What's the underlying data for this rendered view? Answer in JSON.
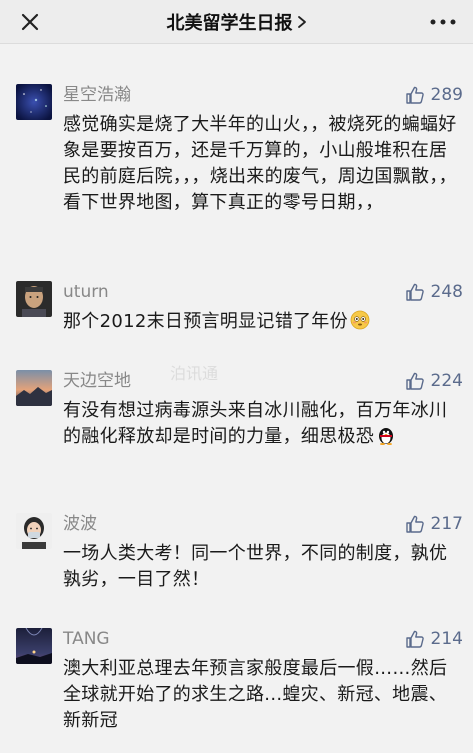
{
  "header": {
    "title": "北美留学生日报",
    "chevron_icon": "chevron-right-icon",
    "close_icon": "close-icon",
    "more_icon": "more-dots-icon"
  },
  "comments": [
    {
      "nickname": "星空浩瀚",
      "likes": "289",
      "text": "感觉确实是烧了大半年的山火，，被烧死的蝙蝠好象是要按百万，还是千万算的，小山般堆积在居民的前庭后院，，，烧出来的废气，周边国飘散，，看下世界地图，算下真正的零号日期，，"
    },
    {
      "nickname": "uturn",
      "likes": "248",
      "text": "那个2012末日预言明显记错了年份",
      "emoji": "flushed-face-emoji"
    },
    {
      "nickname": "天边空地",
      "likes": "224",
      "text": "有没有想过病毒源头来自冰川融化，百万年冰川的融化释放却是时间的力量，细思极恐",
      "emoji": "penguin-emoji"
    },
    {
      "nickname": "波波",
      "likes": "217",
      "text": "一场人类大考！同一个世界，不同的制度，孰优孰劣，一目了然！"
    },
    {
      "nickname": "TANG",
      "likes": "214",
      "text": "澳大利亚总理去年预言家般度最后一假……然后全球就开始了的求生之路...蝗灾、新冠、地震、新新冠"
    }
  ],
  "watermark": {
    "text": "泊讯通"
  },
  "colors": {
    "background": "#f2f2f2",
    "topbar": "#ededed",
    "like_blue": "#5b6b8c",
    "nickname_gray": "#888888"
  }
}
